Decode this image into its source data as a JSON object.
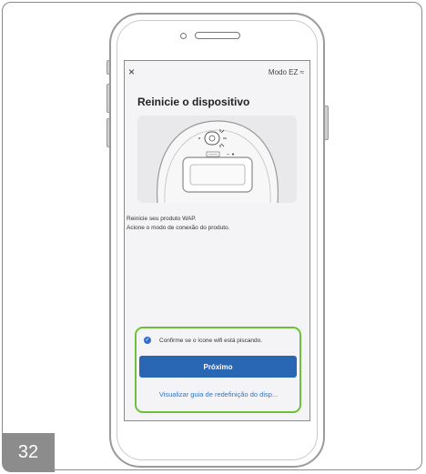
{
  "page": {
    "number": "32"
  },
  "header": {
    "close_icon": "×",
    "mode_label": "Modo EZ ≈"
  },
  "screen": {
    "title": "Reinicie o dispositivo",
    "instructions": [
      "Reinicie seu produto WAP.",
      "Acione o modo de conexão do produto."
    ],
    "checkbox_label": "Confirme se o ícone wifi está piscando.",
    "next_button": "Próximo",
    "guide_link": "Visualizar guia de redefinição do disp..."
  },
  "colors": {
    "accent": "#2966b4",
    "highlight": "#6fbf3e",
    "link": "#2e74c9"
  },
  "icons": {
    "close": "close-icon",
    "wifi_mode": "wifi-icon",
    "check": "check-circle-icon"
  }
}
